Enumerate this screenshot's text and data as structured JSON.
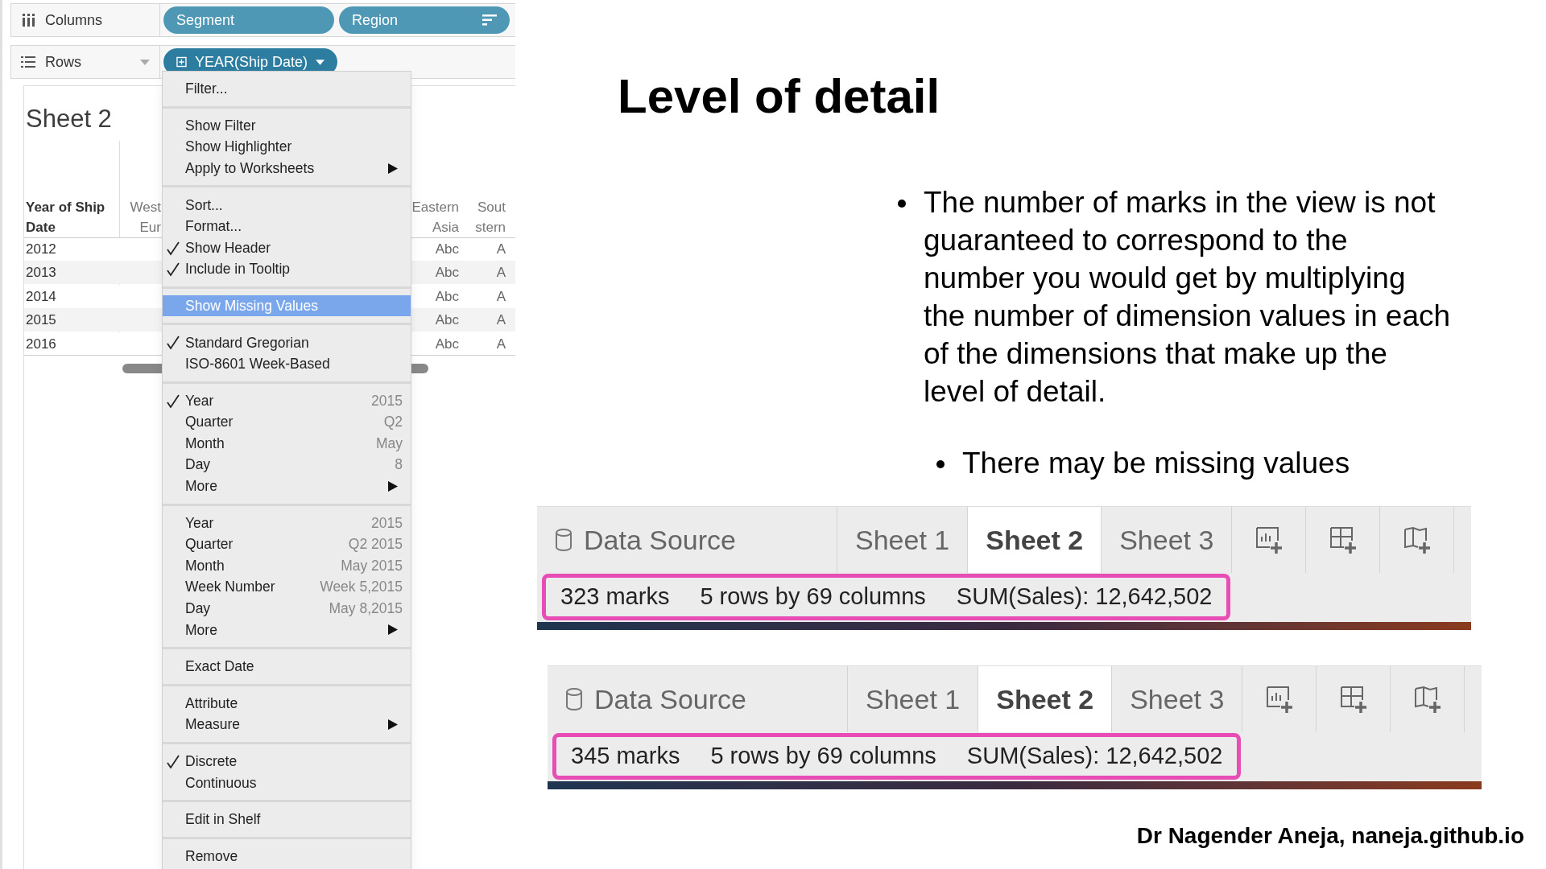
{
  "shelves": [
    {
      "label": "Columns",
      "kind": "columns",
      "pills": [
        {
          "label": "Segment",
          "sort": false,
          "dropdown": false,
          "expand": false
        },
        {
          "label": "Region",
          "sort": true,
          "dropdown": false,
          "expand": false
        }
      ]
    },
    {
      "label": "Rows",
      "kind": "rows",
      "pills": [
        {
          "label": "YEAR(Ship Date)",
          "sort": false,
          "dropdown": true,
          "expand": true
        }
      ]
    }
  ],
  "sheet": {
    "title": "Sheet 2",
    "columns": [
      {
        "lines": [
          "Year of Ship",
          "Date"
        ]
      },
      {
        "lines": [
          "West",
          "Eur"
        ]
      },
      {
        "lines": [
          "Eastern",
          "Asia"
        ]
      },
      {
        "lines": [
          "Sout",
          "stern"
        ]
      }
    ],
    "rows": [
      [
        "2012",
        "",
        "Abc",
        "A"
      ],
      [
        "2013",
        "",
        "Abc",
        "A"
      ],
      [
        "2014",
        "",
        "Abc",
        "A"
      ],
      [
        "2015",
        "",
        "Abc",
        "A"
      ],
      [
        "2016",
        "",
        "Abc",
        "A"
      ]
    ]
  },
  "menu": [
    [
      {
        "label": "Filter...",
        "checked": false,
        "highlighted": false,
        "submenu": false
      }
    ],
    [
      {
        "label": "Show Filter",
        "checked": false,
        "highlighted": false,
        "submenu": false
      },
      {
        "label": "Show Highlighter",
        "checked": false,
        "highlighted": false,
        "submenu": false
      },
      {
        "label": "Apply to Worksheets",
        "checked": false,
        "highlighted": false,
        "submenu": true
      }
    ],
    [
      {
        "label": "Sort...",
        "checked": false,
        "highlighted": false,
        "submenu": false
      },
      {
        "label": "Format...",
        "checked": false,
        "highlighted": false,
        "submenu": false
      },
      {
        "label": "Show Header",
        "checked": true,
        "highlighted": false,
        "submenu": false
      },
      {
        "label": "Include in Tooltip",
        "checked": true,
        "highlighted": false,
        "submenu": false
      }
    ],
    [
      {
        "label": "Show Missing Values",
        "checked": false,
        "highlighted": true,
        "submenu": false
      }
    ],
    [
      {
        "label": "Standard Gregorian",
        "checked": true,
        "highlighted": false,
        "submenu": false
      },
      {
        "label": "ISO-8601 Week-Based",
        "checked": false,
        "highlighted": false,
        "submenu": false
      }
    ],
    [
      {
        "label": "Year",
        "value": "2015",
        "checked": true,
        "highlighted": false,
        "submenu": false
      },
      {
        "label": "Quarter",
        "value": "Q2",
        "checked": false,
        "highlighted": false,
        "submenu": false
      },
      {
        "label": "Month",
        "value": "May",
        "checked": false,
        "highlighted": false,
        "submenu": false
      },
      {
        "label": "Day",
        "value": "8",
        "checked": false,
        "highlighted": false,
        "submenu": false
      },
      {
        "label": "More",
        "checked": false,
        "highlighted": false,
        "submenu": true
      }
    ],
    [
      {
        "label": "Year",
        "value": "2015",
        "checked": false,
        "highlighted": false,
        "submenu": false
      },
      {
        "label": "Quarter",
        "value": "Q2 2015",
        "checked": false,
        "highlighted": false,
        "submenu": false
      },
      {
        "label": "Month",
        "value": "May 2015",
        "checked": false,
        "highlighted": false,
        "submenu": false
      },
      {
        "label": "Week Number",
        "value": "Week 5,2015",
        "checked": false,
        "highlighted": false,
        "submenu": false
      },
      {
        "label": "Day",
        "value": "May 8,2015",
        "checked": false,
        "highlighted": false,
        "submenu": false
      },
      {
        "label": "More",
        "checked": false,
        "highlighted": false,
        "submenu": true
      }
    ],
    [
      {
        "label": "Exact Date",
        "checked": false,
        "highlighted": false,
        "submenu": false
      }
    ],
    [
      {
        "label": "Attribute",
        "checked": false,
        "highlighted": false,
        "submenu": false
      },
      {
        "label": "Measure",
        "checked": false,
        "highlighted": false,
        "submenu": true
      }
    ],
    [
      {
        "label": "Discrete",
        "checked": true,
        "highlighted": false,
        "submenu": false
      },
      {
        "label": "Continuous",
        "checked": false,
        "highlighted": false,
        "submenu": false
      }
    ],
    [
      {
        "label": "Edit in Shelf",
        "checked": false,
        "highlighted": false,
        "submenu": false
      }
    ],
    [
      {
        "label": "Remove",
        "checked": false,
        "highlighted": false,
        "submenu": false
      }
    ]
  ],
  "slide": {
    "title": "Level of detail",
    "bullets": [
      {
        "text": "The number of marks in the view is not guaranteed to correspond to the number you would get by multiplying the number of dimension values in each of the dimensions that make up the level of detail.",
        "children": [
          {
            "text": "There may be missing values"
          }
        ]
      }
    ],
    "strips": [
      {
        "tabs": [
          {
            "label": "Data Source",
            "kind": "data-source",
            "selected": false
          },
          {
            "label": "Sheet 1",
            "kind": "sheet",
            "selected": false
          },
          {
            "label": "Sheet 2",
            "kind": "sheet",
            "selected": true
          },
          {
            "label": "Sheet 3",
            "kind": "sheet",
            "selected": false
          }
        ],
        "status": [
          "323 marks",
          "5 rows by 69 columns",
          "SUM(Sales): 12,642,502"
        ],
        "highlighted": true
      },
      {
        "tabs": [
          {
            "label": "Data Source",
            "kind": "data-source",
            "selected": false
          },
          {
            "label": "Sheet 1",
            "kind": "sheet",
            "selected": false
          },
          {
            "label": "Sheet 2",
            "kind": "sheet",
            "selected": true
          },
          {
            "label": "Sheet 3",
            "kind": "sheet",
            "selected": false
          }
        ],
        "status": [
          "345 marks",
          "5 rows by 69 columns",
          "SUM(Sales): 12,642,502"
        ],
        "highlighted": true
      }
    ],
    "footer": "Dr Nagender Aneja, naneja.github.io"
  }
}
